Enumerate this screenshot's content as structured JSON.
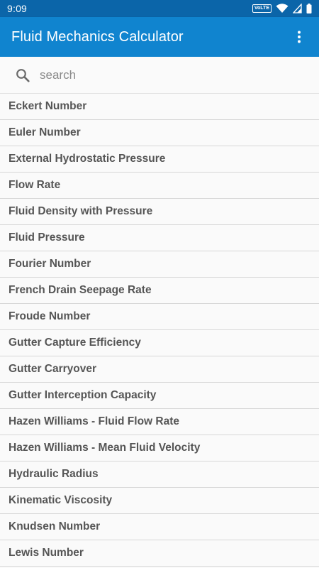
{
  "status_bar": {
    "time": "9:09",
    "network_badge": "VoLTE",
    "icons": [
      "volte-icon",
      "wifi-icon",
      "cell-signal-icon",
      "battery-icon"
    ]
  },
  "app_bar": {
    "title": "Fluid Mechanics Calculator",
    "menu_icon": "more-vert-icon",
    "color": "#1084cf"
  },
  "search": {
    "placeholder": "search",
    "value": "",
    "icon": "search-icon"
  },
  "items": [
    {
      "label": "Eckert Number"
    },
    {
      "label": "Euler Number"
    },
    {
      "label": "External Hydrostatic Pressure"
    },
    {
      "label": "Flow Rate"
    },
    {
      "label": "Fluid Density with Pressure"
    },
    {
      "label": "Fluid Pressure"
    },
    {
      "label": "Fourier Number"
    },
    {
      "label": "French Drain Seepage Rate"
    },
    {
      "label": "Froude Number"
    },
    {
      "label": "Gutter Capture Efficiency"
    },
    {
      "label": "Gutter Carryover"
    },
    {
      "label": "Gutter Interception Capacity"
    },
    {
      "label": "Hazen Williams - Fluid Flow Rate"
    },
    {
      "label": "Hazen Williams - Mean Fluid Velocity"
    },
    {
      "label": "Hydraulic Radius"
    },
    {
      "label": "Kinematic Viscosity"
    },
    {
      "label": "Knudsen Number"
    },
    {
      "label": "Lewis Number"
    }
  ]
}
